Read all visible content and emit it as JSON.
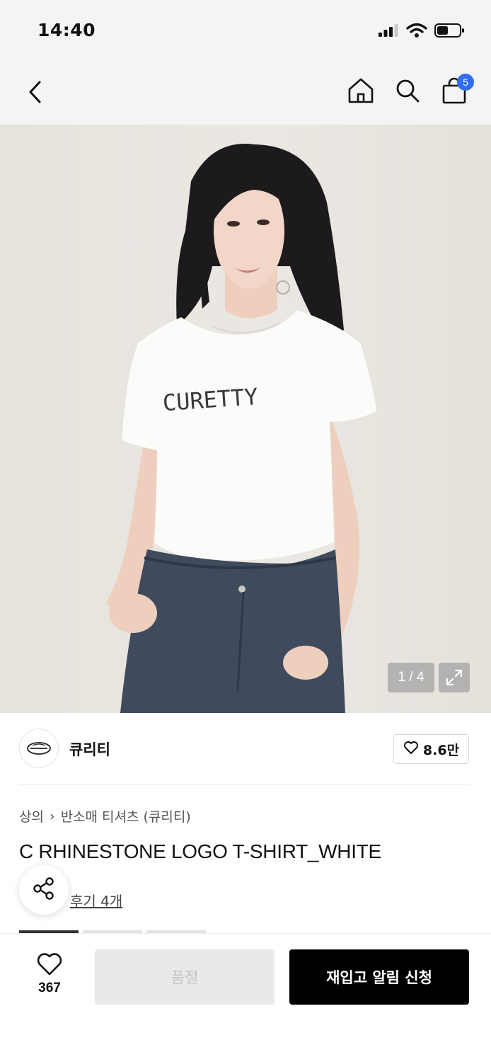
{
  "status_bar": {
    "time": "14:40",
    "icons": [
      "cellular-signal-icon",
      "wifi-icon",
      "battery-icon"
    ]
  },
  "nav": {
    "icons": [
      "back-chevron-icon",
      "home-icon",
      "search-icon",
      "cart-bag-icon"
    ],
    "cart_badge": "5",
    "badge_color": "#2f6df2"
  },
  "gallery": {
    "image_counter": "1 / 4",
    "tshirt_print": "CURETTY",
    "expand_icon": "expand-icon"
  },
  "brand": {
    "name": "큐리티",
    "like_count": "8.6만"
  },
  "product": {
    "breadcrumb": [
      "상의",
      "반소매 티셔츠 (큐리티)"
    ],
    "title": "C RHINESTONE LOGO T-SHIRT_WHITE",
    "review_link": "후기 4개"
  },
  "bottom_bar": {
    "wish_count": "367",
    "soldout_label": "품절",
    "restock_label": "재입고 알림 신청",
    "primary_color": "#000000"
  }
}
